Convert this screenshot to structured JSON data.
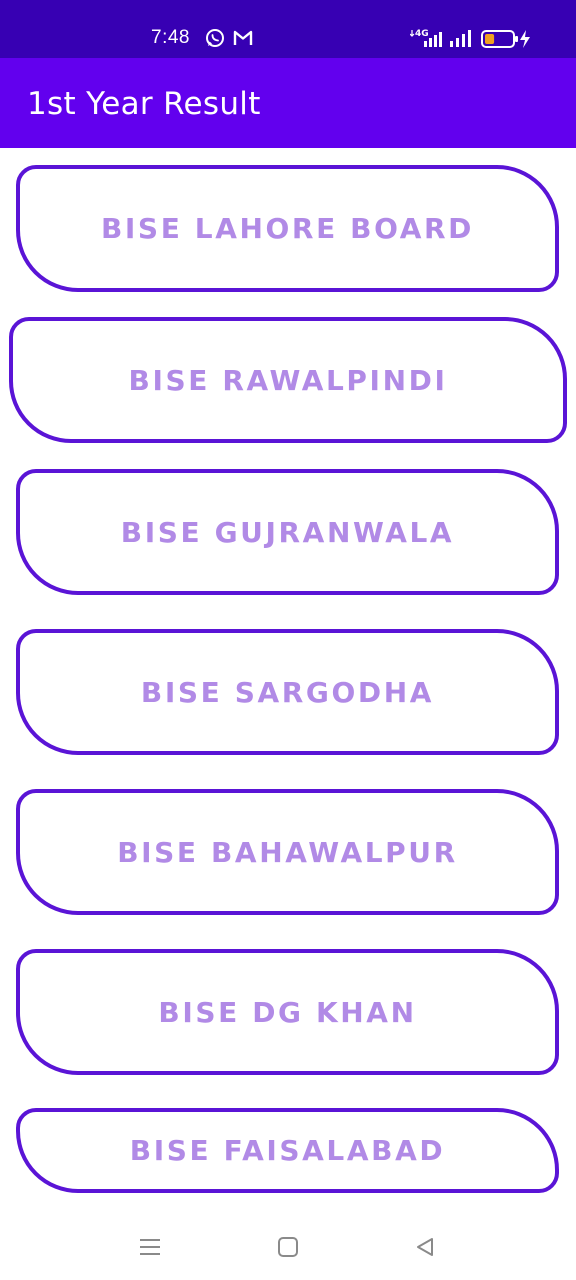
{
  "status_bar": {
    "time": "7:48",
    "network": "4G",
    "icons": [
      "whatsapp-icon",
      "gmail-icon",
      "signal-icon",
      "battery-icon",
      "charging-icon"
    ],
    "battery_level": 0.35,
    "colors": {
      "background": "#3700b3",
      "battery_fill": "#f0a020"
    }
  },
  "app_bar": {
    "title": "1st Year Result",
    "color": "#6200ee"
  },
  "boards": [
    {
      "label": "BISE LAHORE BOARD"
    },
    {
      "label": "BISE RAWALPINDI"
    },
    {
      "label": "BISE GUJRANWALA"
    },
    {
      "label": "BISE SARGODHA"
    },
    {
      "label": "BISE BAHAWALPUR"
    },
    {
      "label": "BISE DG KHAN"
    },
    {
      "label": "BISE FAISALABAD"
    }
  ],
  "theme": {
    "button_border": "#5a14d6",
    "button_text": "#b18ae6"
  },
  "nav_bar": {
    "icons": [
      "menu-icon",
      "home-icon",
      "back-icon"
    ]
  }
}
